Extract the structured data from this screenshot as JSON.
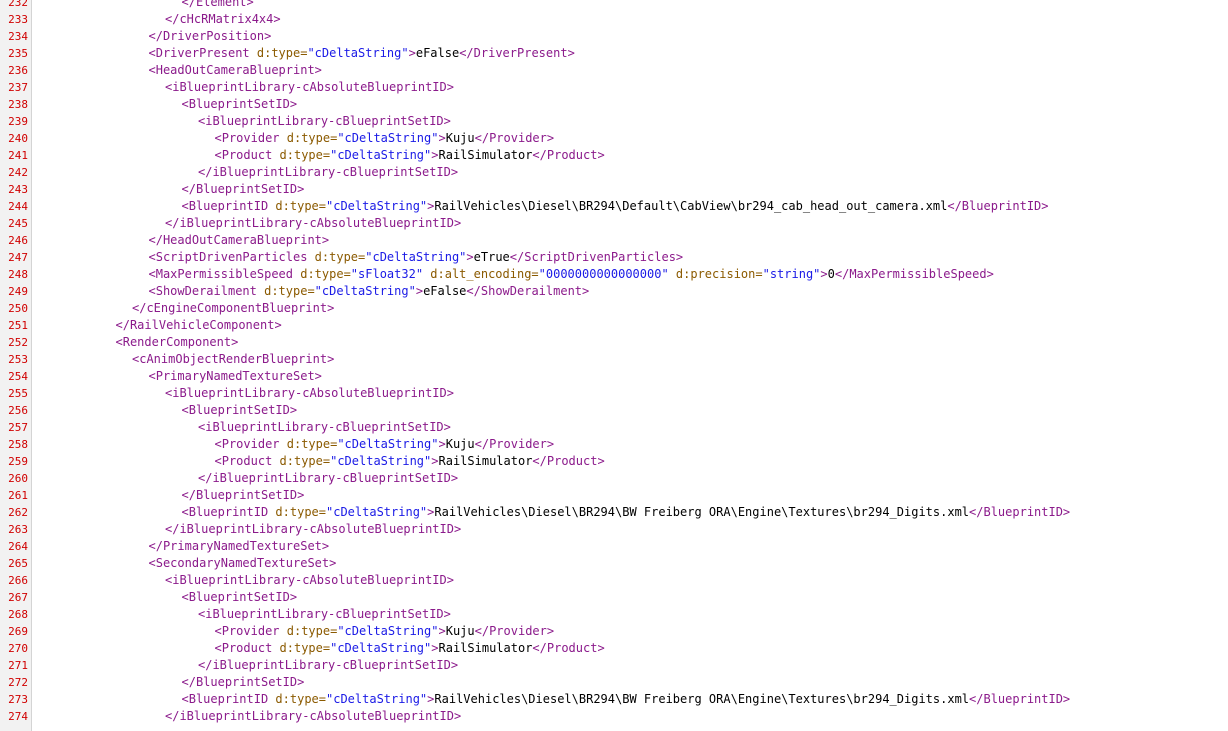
{
  "colors": {
    "line_number": "#d00000",
    "tag": "#8b1a8b",
    "attribute": "#8b5a00",
    "value": "#1a1ae6",
    "text": "#000000",
    "gutter": "#f2f2f2"
  },
  "lines": [
    {
      "num": "232",
      "indent": 9,
      "tokens": [
        {
          "t": "tag",
          "v": "</Element>"
        }
      ]
    },
    {
      "num": "233",
      "indent": 8,
      "tokens": [
        {
          "t": "tag",
          "v": "</cHcRMatrix4x4>"
        }
      ]
    },
    {
      "num": "234",
      "indent": 7,
      "tokens": [
        {
          "t": "tag",
          "v": "</DriverPosition>"
        }
      ]
    },
    {
      "num": "235",
      "indent": 7,
      "tokens": [
        {
          "t": "tag",
          "v": "<DriverPresent "
        },
        {
          "t": "attr",
          "v": "d:type="
        },
        {
          "t": "val",
          "v": "\"cDeltaString\""
        },
        {
          "t": "tag",
          "v": ">"
        },
        {
          "t": "txt",
          "v": "eFalse"
        },
        {
          "t": "tag",
          "v": "</DriverPresent>"
        }
      ]
    },
    {
      "num": "236",
      "indent": 7,
      "tokens": [
        {
          "t": "tag",
          "v": "<HeadOutCameraBlueprint>"
        }
      ]
    },
    {
      "num": "237",
      "indent": 8,
      "tokens": [
        {
          "t": "tag",
          "v": "<iBlueprintLibrary-cAbsoluteBlueprintID>"
        }
      ]
    },
    {
      "num": "238",
      "indent": 9,
      "tokens": [
        {
          "t": "tag",
          "v": "<BlueprintSetID>"
        }
      ]
    },
    {
      "num": "239",
      "indent": 10,
      "tokens": [
        {
          "t": "tag",
          "v": "<iBlueprintLibrary-cBlueprintSetID>"
        }
      ]
    },
    {
      "num": "240",
      "indent": 11,
      "tokens": [
        {
          "t": "tag",
          "v": "<Provider "
        },
        {
          "t": "attr",
          "v": "d:type="
        },
        {
          "t": "val",
          "v": "\"cDeltaString\""
        },
        {
          "t": "tag",
          "v": ">"
        },
        {
          "t": "txt",
          "v": "Kuju"
        },
        {
          "t": "tag",
          "v": "</Provider>"
        }
      ]
    },
    {
      "num": "241",
      "indent": 11,
      "tokens": [
        {
          "t": "tag",
          "v": "<Product "
        },
        {
          "t": "attr",
          "v": "d:type="
        },
        {
          "t": "val",
          "v": "\"cDeltaString\""
        },
        {
          "t": "tag",
          "v": ">"
        },
        {
          "t": "txt",
          "v": "RailSimulator"
        },
        {
          "t": "tag",
          "v": "</Product>"
        }
      ]
    },
    {
      "num": "242",
      "indent": 10,
      "tokens": [
        {
          "t": "tag",
          "v": "</iBlueprintLibrary-cBlueprintSetID>"
        }
      ]
    },
    {
      "num": "243",
      "indent": 9,
      "tokens": [
        {
          "t": "tag",
          "v": "</BlueprintSetID>"
        }
      ]
    },
    {
      "num": "244",
      "indent": 9,
      "tokens": [
        {
          "t": "tag",
          "v": "<BlueprintID "
        },
        {
          "t": "attr",
          "v": "d:type="
        },
        {
          "t": "val",
          "v": "\"cDeltaString\""
        },
        {
          "t": "tag",
          "v": ">"
        },
        {
          "t": "txt",
          "v": "RailVehicles\\Diesel\\BR294\\Default\\CabView\\br294_cab_head_out_camera.xml"
        },
        {
          "t": "tag",
          "v": "</BlueprintID>"
        }
      ]
    },
    {
      "num": "245",
      "indent": 8,
      "tokens": [
        {
          "t": "tag",
          "v": "</iBlueprintLibrary-cAbsoluteBlueprintID>"
        }
      ]
    },
    {
      "num": "246",
      "indent": 7,
      "tokens": [
        {
          "t": "tag",
          "v": "</HeadOutCameraBlueprint>"
        }
      ]
    },
    {
      "num": "247",
      "indent": 7,
      "tokens": [
        {
          "t": "tag",
          "v": "<ScriptDrivenParticles "
        },
        {
          "t": "attr",
          "v": "d:type="
        },
        {
          "t": "val",
          "v": "\"cDeltaString\""
        },
        {
          "t": "tag",
          "v": ">"
        },
        {
          "t": "txt",
          "v": "eTrue"
        },
        {
          "t": "tag",
          "v": "</ScriptDrivenParticles>"
        }
      ]
    },
    {
      "num": "248",
      "indent": 7,
      "tokens": [
        {
          "t": "tag",
          "v": "<MaxPermissibleSpeed "
        },
        {
          "t": "attr",
          "v": "d:type="
        },
        {
          "t": "val",
          "v": "\"sFloat32\""
        },
        {
          "t": "attr",
          "v": " d:alt_encoding="
        },
        {
          "t": "val",
          "v": "\"0000000000000000\""
        },
        {
          "t": "attr",
          "v": " d:precision="
        },
        {
          "t": "val",
          "v": "\"string\""
        },
        {
          "t": "tag",
          "v": ">"
        },
        {
          "t": "txt",
          "v": "0"
        },
        {
          "t": "tag",
          "v": "</MaxPermissibleSpeed>"
        }
      ]
    },
    {
      "num": "249",
      "indent": 7,
      "tokens": [
        {
          "t": "tag",
          "v": "<ShowDerailment "
        },
        {
          "t": "attr",
          "v": "d:type="
        },
        {
          "t": "val",
          "v": "\"cDeltaString\""
        },
        {
          "t": "tag",
          "v": ">"
        },
        {
          "t": "txt",
          "v": "eFalse"
        },
        {
          "t": "tag",
          "v": "</ShowDerailment>"
        }
      ]
    },
    {
      "num": "250",
      "indent": 6,
      "tokens": [
        {
          "t": "tag",
          "v": "</cEngineComponentBlueprint>"
        }
      ]
    },
    {
      "num": "251",
      "indent": 5,
      "tokens": [
        {
          "t": "tag",
          "v": "</RailVehicleComponent>"
        }
      ]
    },
    {
      "num": "252",
      "indent": 5,
      "tokens": [
        {
          "t": "tag",
          "v": "<RenderComponent>"
        }
      ]
    },
    {
      "num": "253",
      "indent": 6,
      "tokens": [
        {
          "t": "tag",
          "v": "<cAnimObjectRenderBlueprint>"
        }
      ]
    },
    {
      "num": "254",
      "indent": 7,
      "tokens": [
        {
          "t": "tag",
          "v": "<PrimaryNamedTextureSet>"
        }
      ]
    },
    {
      "num": "255",
      "indent": 8,
      "tokens": [
        {
          "t": "tag",
          "v": "<iBlueprintLibrary-cAbsoluteBlueprintID>"
        }
      ]
    },
    {
      "num": "256",
      "indent": 9,
      "tokens": [
        {
          "t": "tag",
          "v": "<BlueprintSetID>"
        }
      ]
    },
    {
      "num": "257",
      "indent": 10,
      "tokens": [
        {
          "t": "tag",
          "v": "<iBlueprintLibrary-cBlueprintSetID>"
        }
      ]
    },
    {
      "num": "258",
      "indent": 11,
      "tokens": [
        {
          "t": "tag",
          "v": "<Provider "
        },
        {
          "t": "attr",
          "v": "d:type="
        },
        {
          "t": "val",
          "v": "\"cDeltaString\""
        },
        {
          "t": "tag",
          "v": ">"
        },
        {
          "t": "txt",
          "v": "Kuju"
        },
        {
          "t": "tag",
          "v": "</Provider>"
        }
      ]
    },
    {
      "num": "259",
      "indent": 11,
      "tokens": [
        {
          "t": "tag",
          "v": "<Product "
        },
        {
          "t": "attr",
          "v": "d:type="
        },
        {
          "t": "val",
          "v": "\"cDeltaString\""
        },
        {
          "t": "tag",
          "v": ">"
        },
        {
          "t": "txt",
          "v": "RailSimulator"
        },
        {
          "t": "tag",
          "v": "</Product>"
        }
      ]
    },
    {
      "num": "260",
      "indent": 10,
      "tokens": [
        {
          "t": "tag",
          "v": "</iBlueprintLibrary-cBlueprintSetID>"
        }
      ]
    },
    {
      "num": "261",
      "indent": 9,
      "tokens": [
        {
          "t": "tag",
          "v": "</BlueprintSetID>"
        }
      ]
    },
    {
      "num": "262",
      "indent": 9,
      "tokens": [
        {
          "t": "tag",
          "v": "<BlueprintID "
        },
        {
          "t": "attr",
          "v": "d:type="
        },
        {
          "t": "val",
          "v": "\"cDeltaString\""
        },
        {
          "t": "tag",
          "v": ">"
        },
        {
          "t": "txt",
          "v": "RailVehicles\\Diesel\\BR294\\BW Freiberg ORA\\Engine\\Textures\\br294_Digits.xml"
        },
        {
          "t": "tag",
          "v": "</BlueprintID>"
        }
      ]
    },
    {
      "num": "263",
      "indent": 8,
      "tokens": [
        {
          "t": "tag",
          "v": "</iBlueprintLibrary-cAbsoluteBlueprintID>"
        }
      ]
    },
    {
      "num": "264",
      "indent": 7,
      "tokens": [
        {
          "t": "tag",
          "v": "</PrimaryNamedTextureSet>"
        }
      ]
    },
    {
      "num": "265",
      "indent": 7,
      "tokens": [
        {
          "t": "tag",
          "v": "<SecondaryNamedTextureSet>"
        }
      ]
    },
    {
      "num": "266",
      "indent": 8,
      "tokens": [
        {
          "t": "tag",
          "v": "<iBlueprintLibrary-cAbsoluteBlueprintID>"
        }
      ]
    },
    {
      "num": "267",
      "indent": 9,
      "tokens": [
        {
          "t": "tag",
          "v": "<BlueprintSetID>"
        }
      ]
    },
    {
      "num": "268",
      "indent": 10,
      "tokens": [
        {
          "t": "tag",
          "v": "<iBlueprintLibrary-cBlueprintSetID>"
        }
      ]
    },
    {
      "num": "269",
      "indent": 11,
      "tokens": [
        {
          "t": "tag",
          "v": "<Provider "
        },
        {
          "t": "attr",
          "v": "d:type="
        },
        {
          "t": "val",
          "v": "\"cDeltaString\""
        },
        {
          "t": "tag",
          "v": ">"
        },
        {
          "t": "txt",
          "v": "Kuju"
        },
        {
          "t": "tag",
          "v": "</Provider>"
        }
      ]
    },
    {
      "num": "270",
      "indent": 11,
      "tokens": [
        {
          "t": "tag",
          "v": "<Product "
        },
        {
          "t": "attr",
          "v": "d:type="
        },
        {
          "t": "val",
          "v": "\"cDeltaString\""
        },
        {
          "t": "tag",
          "v": ">"
        },
        {
          "t": "txt",
          "v": "RailSimulator"
        },
        {
          "t": "tag",
          "v": "</Product>"
        }
      ]
    },
    {
      "num": "271",
      "indent": 10,
      "tokens": [
        {
          "t": "tag",
          "v": "</iBlueprintLibrary-cBlueprintSetID>"
        }
      ]
    },
    {
      "num": "272",
      "indent": 9,
      "tokens": [
        {
          "t": "tag",
          "v": "</BlueprintSetID>"
        }
      ]
    },
    {
      "num": "273",
      "indent": 9,
      "tokens": [
        {
          "t": "tag",
          "v": "<BlueprintID "
        },
        {
          "t": "attr",
          "v": "d:type="
        },
        {
          "t": "val",
          "v": "\"cDeltaString\""
        },
        {
          "t": "tag",
          "v": ">"
        },
        {
          "t": "txt",
          "v": "RailVehicles\\Diesel\\BR294\\BW Freiberg ORA\\Engine\\Textures\\br294_Digits.xml"
        },
        {
          "t": "tag",
          "v": "</BlueprintID>"
        }
      ]
    },
    {
      "num": "274",
      "indent": 8,
      "tokens": [
        {
          "t": "tag",
          "v": "</iBlueprintLibrary-cAbsoluteBlueprintID>"
        }
      ]
    }
  ]
}
